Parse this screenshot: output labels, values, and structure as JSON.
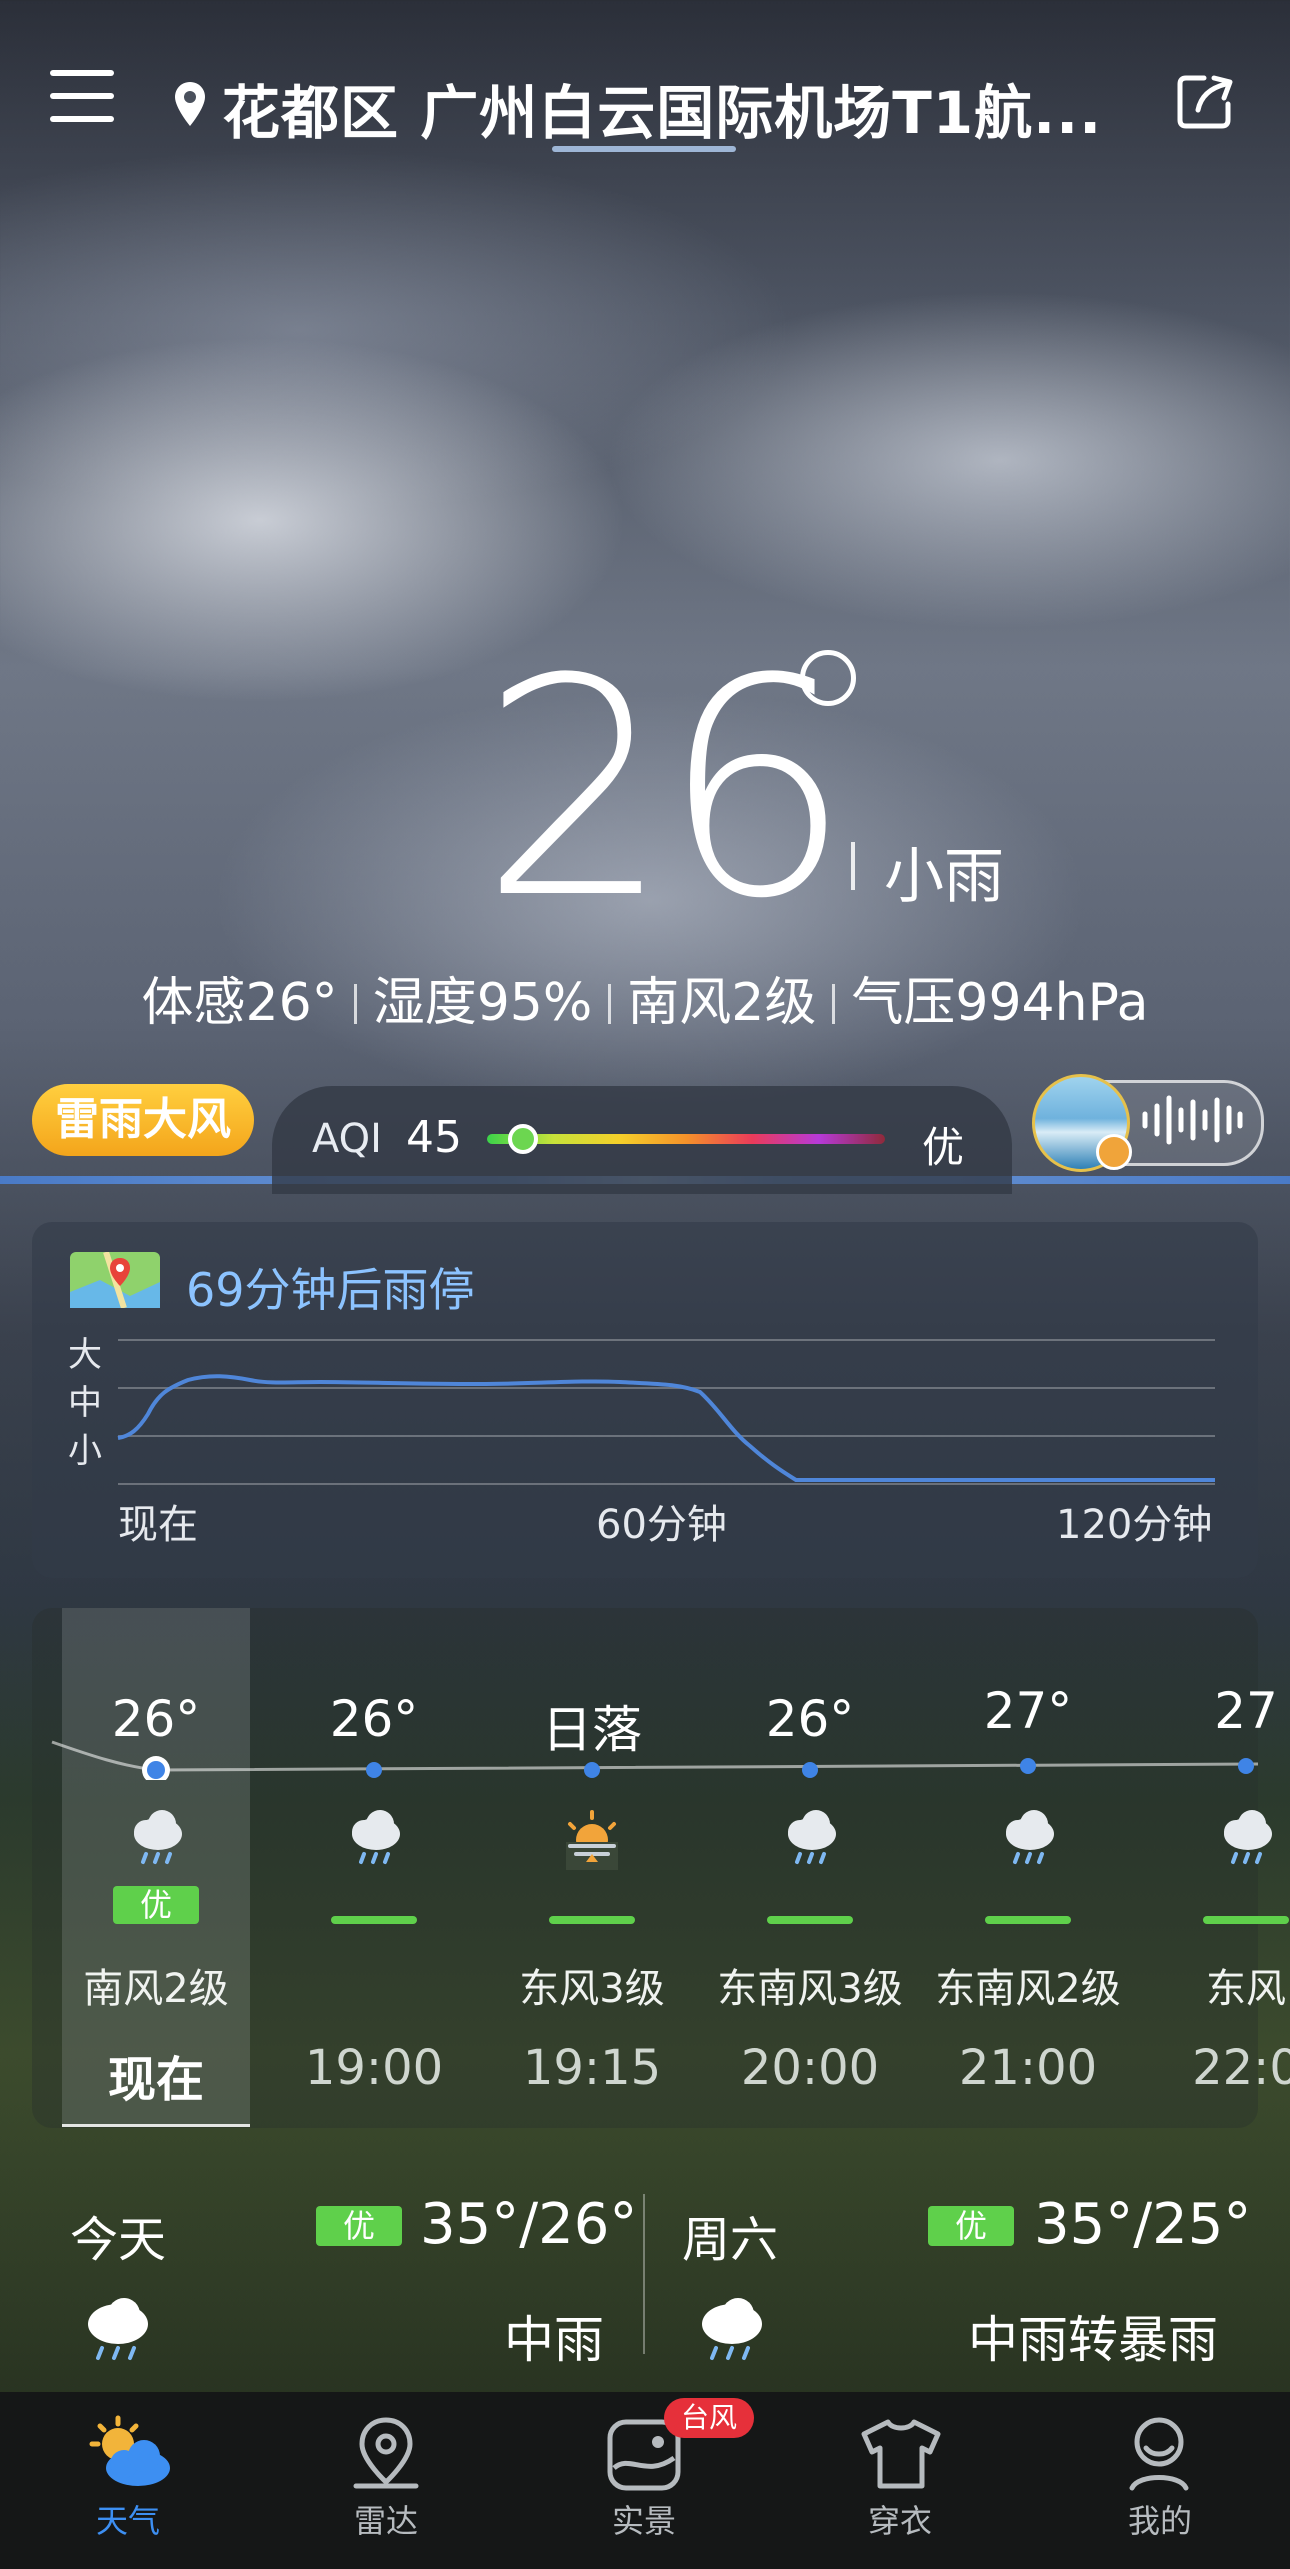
{
  "header": {
    "location": "花都区 广州白云国际机场T1航...",
    "menu_icon": "menu-icon",
    "pin_icon": "location-pin-icon",
    "share_icon": "share-icon"
  },
  "current": {
    "temperature": "26",
    "condition": "小雨",
    "feels_like": "体感26°",
    "humidity": "湿度95%",
    "wind": "南风2级",
    "pressure": "气压994hPa"
  },
  "alert": {
    "label": "雷雨大风",
    "color": "#f4b22a"
  },
  "aqi": {
    "label": "AQI",
    "value": "45",
    "level": "优",
    "fraction": 0.09
  },
  "rain": {
    "title": "69分钟后雨停",
    "y_labels": [
      "大",
      "中",
      "小"
    ],
    "x_labels": [
      "现在",
      "60分钟",
      "120分钟"
    ]
  },
  "hourly": [
    {
      "temp": "26°",
      "icon": "rain-icon",
      "aqi": "优",
      "wind": "南风2级",
      "time": "现在"
    },
    {
      "temp": "26°",
      "icon": "rain-icon",
      "aqi": "",
      "wind": "",
      "time": "19:00"
    },
    {
      "temp": "日落",
      "icon": "sunset-icon",
      "aqi": "",
      "wind": "东风3级",
      "time": "19:15"
    },
    {
      "temp": "26°",
      "icon": "rain-icon",
      "aqi": "",
      "wind": "东南风3级",
      "time": "20:00"
    },
    {
      "temp": "27°",
      "icon": "rain-icon",
      "aqi": "",
      "wind": "东南风2级",
      "time": "21:00"
    },
    {
      "temp": "27",
      "icon": "rain-icon",
      "aqi": "",
      "wind": "东风",
      "time": "22:0"
    }
  ],
  "daily": [
    {
      "day": "今天",
      "aqi": "优",
      "temp": "35°/26°",
      "condition": "中雨",
      "icon": "rain-icon"
    },
    {
      "day": "周六",
      "aqi": "优",
      "temp": "35°/25°",
      "condition": "中雨转暴雨",
      "icon": "rain-icon"
    }
  ],
  "tabs": [
    {
      "label": "天气",
      "icon": "weather-icon",
      "active": true
    },
    {
      "label": "雷达",
      "icon": "radar-icon",
      "active": false
    },
    {
      "label": "实景",
      "icon": "photo-icon",
      "active": false,
      "badge": "台风"
    },
    {
      "label": "穿衣",
      "icon": "clothing-icon",
      "active": false
    },
    {
      "label": "我的",
      "icon": "profile-icon",
      "active": false
    }
  ]
}
